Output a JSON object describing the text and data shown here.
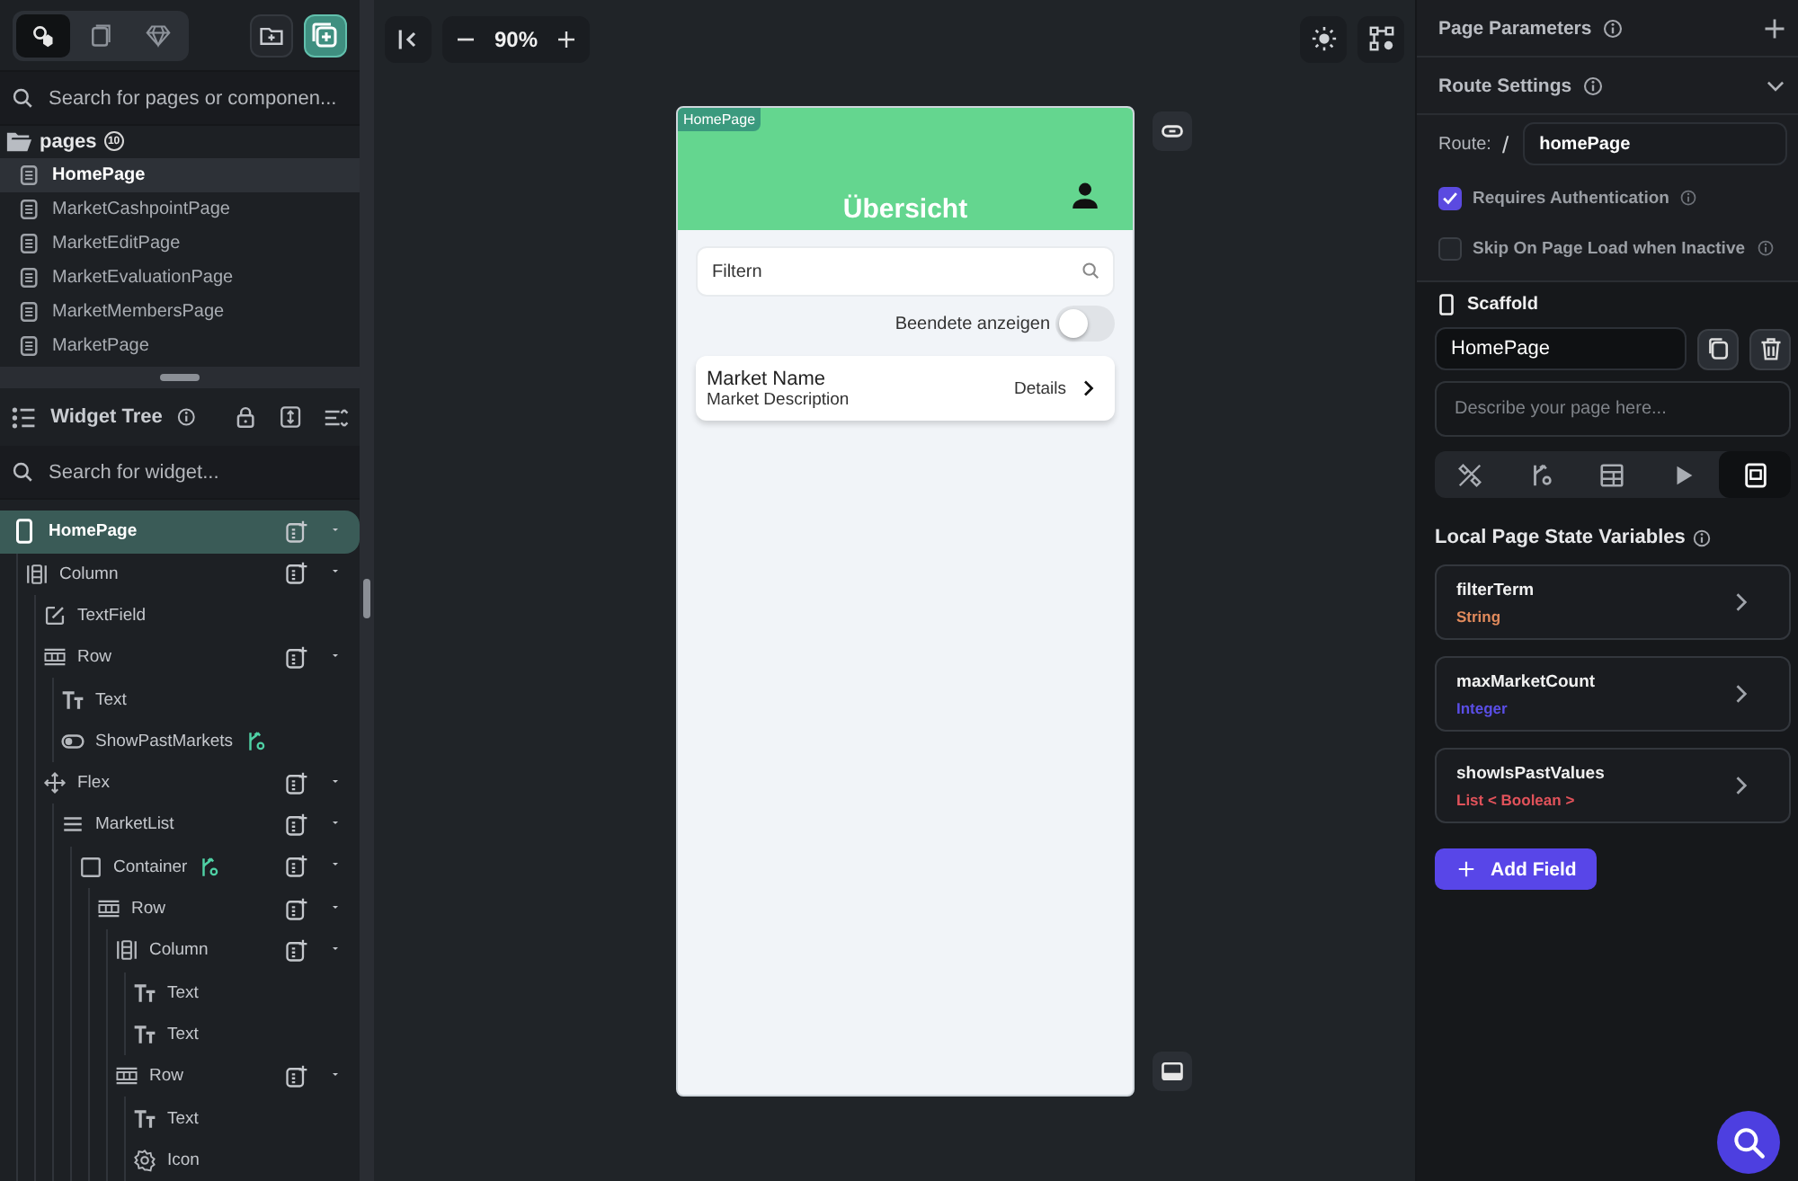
{
  "left_panel": {
    "view_tabs": [
      {
        "selected": true
      },
      {
        "selected": false
      },
      {
        "selected": false
      }
    ],
    "page_search": {
      "placeholder": "Search for pages or componen..."
    },
    "pages_folder": {
      "label": "pages",
      "count": "10"
    },
    "pages": [
      {
        "label": "HomePage",
        "selected": true
      },
      {
        "label": "MarketCashpointPage",
        "selected": false
      },
      {
        "label": "MarketEditPage",
        "selected": false
      },
      {
        "label": "MarketEvaluationPage",
        "selected": false
      },
      {
        "label": "MarketMembersPage",
        "selected": false
      },
      {
        "label": "MarketPage",
        "selected": false
      }
    ],
    "widget_tree": {
      "title": "Widget Tree",
      "search": {
        "placeholder": "Search for widget..."
      },
      "nodes": [
        {
          "label": "HomePage",
          "kind": "page",
          "selected": true,
          "addable": true,
          "logic": false,
          "children": [
            {
              "label": "Column",
              "kind": "column",
              "selected": false,
              "addable": true,
              "logic": false,
              "children": [
                {
                  "label": "TextField",
                  "kind": "textfield",
                  "selected": false,
                  "addable": false,
                  "logic": false
                },
                {
                  "label": "Row",
                  "kind": "row",
                  "selected": false,
                  "addable": true,
                  "logic": false,
                  "children": [
                    {
                      "label": "Text",
                      "kind": "text",
                      "selected": false,
                      "addable": false,
                      "logic": false
                    },
                    {
                      "label": "ShowPastMarkets",
                      "kind": "switch",
                      "selected": false,
                      "addable": false,
                      "logic": true
                    }
                  ]
                },
                {
                  "label": "Flex",
                  "kind": "flex",
                  "selected": false,
                  "addable": true,
                  "logic": false,
                  "children": [
                    {
                      "label": "MarketList",
                      "kind": "list",
                      "selected": false,
                      "addable": true,
                      "logic": false,
                      "children": [
                        {
                          "label": "Container",
                          "kind": "container",
                          "selected": false,
                          "addable": true,
                          "logic": true,
                          "children": [
                            {
                              "label": "Row",
                              "kind": "row",
                              "selected": false,
                              "addable": true,
                              "logic": false,
                              "children": [
                                {
                                  "label": "Column",
                                  "kind": "column",
                                  "selected": false,
                                  "addable": true,
                                  "logic": false,
                                  "children": [
                                    {
                                      "label": "Text",
                                      "kind": "text",
                                      "selected": false,
                                      "addable": false,
                                      "logic": false
                                    },
                                    {
                                      "label": "Text",
                                      "kind": "text",
                                      "selected": false,
                                      "addable": false,
                                      "logic": false
                                    }
                                  ]
                                },
                                {
                                  "label": "Row",
                                  "kind": "row",
                                  "selected": false,
                                  "addable": true,
                                  "logic": false,
                                  "children": [
                                    {
                                      "label": "Text",
                                      "kind": "text",
                                      "selected": false,
                                      "addable": false,
                                      "logic": false
                                    },
                                    {
                                      "label": "Icon",
                                      "kind": "icon",
                                      "selected": false,
                                      "addable": false,
                                      "logic": false
                                    }
                                  ]
                                }
                              ]
                            }
                          ]
                        }
                      ]
                    }
                  ]
                }
              ]
            }
          ]
        }
      ]
    }
  },
  "canvas": {
    "zoom": "90%",
    "page_tag": "HomePage",
    "app_bar_title": "Übersicht",
    "filter": {
      "placeholder": "Filtern"
    },
    "toggle": {
      "label": "Beendete anzeigen",
      "on": false
    },
    "market_card": {
      "name": "Market Name",
      "description": "Market Description",
      "action": "Details"
    }
  },
  "properties": {
    "page_parameters": {
      "title": "Page Parameters"
    },
    "route_settings": {
      "title": "Route Settings",
      "route_label": "Route:",
      "slash": "/",
      "route": "homePage",
      "options": [
        {
          "label": "Requires Authentication",
          "checked": true
        },
        {
          "label": "Skip On Page Load when Inactive",
          "checked": false
        }
      ]
    },
    "scaffold": {
      "title": "Scaffold",
      "name": "HomePage",
      "description": {
        "placeholder": "Describe your page here..."
      },
      "tabs": [
        {
          "selected": false
        },
        {
          "selected": false
        },
        {
          "selected": false
        },
        {
          "selected": false
        },
        {
          "selected": true
        }
      ]
    },
    "state_variables": {
      "title": "Local Page State Variables",
      "items": [
        {
          "name": "filterTerm",
          "type": "String",
          "color": "#e08a5c"
        },
        {
          "name": "maxMarketCount",
          "type": "Integer",
          "color": "#5a4ee6"
        },
        {
          "name": "showIsPastValues",
          "type": "List < Boolean >",
          "color": "#e0525a"
        }
      ],
      "add_button": "Add Field"
    }
  }
}
